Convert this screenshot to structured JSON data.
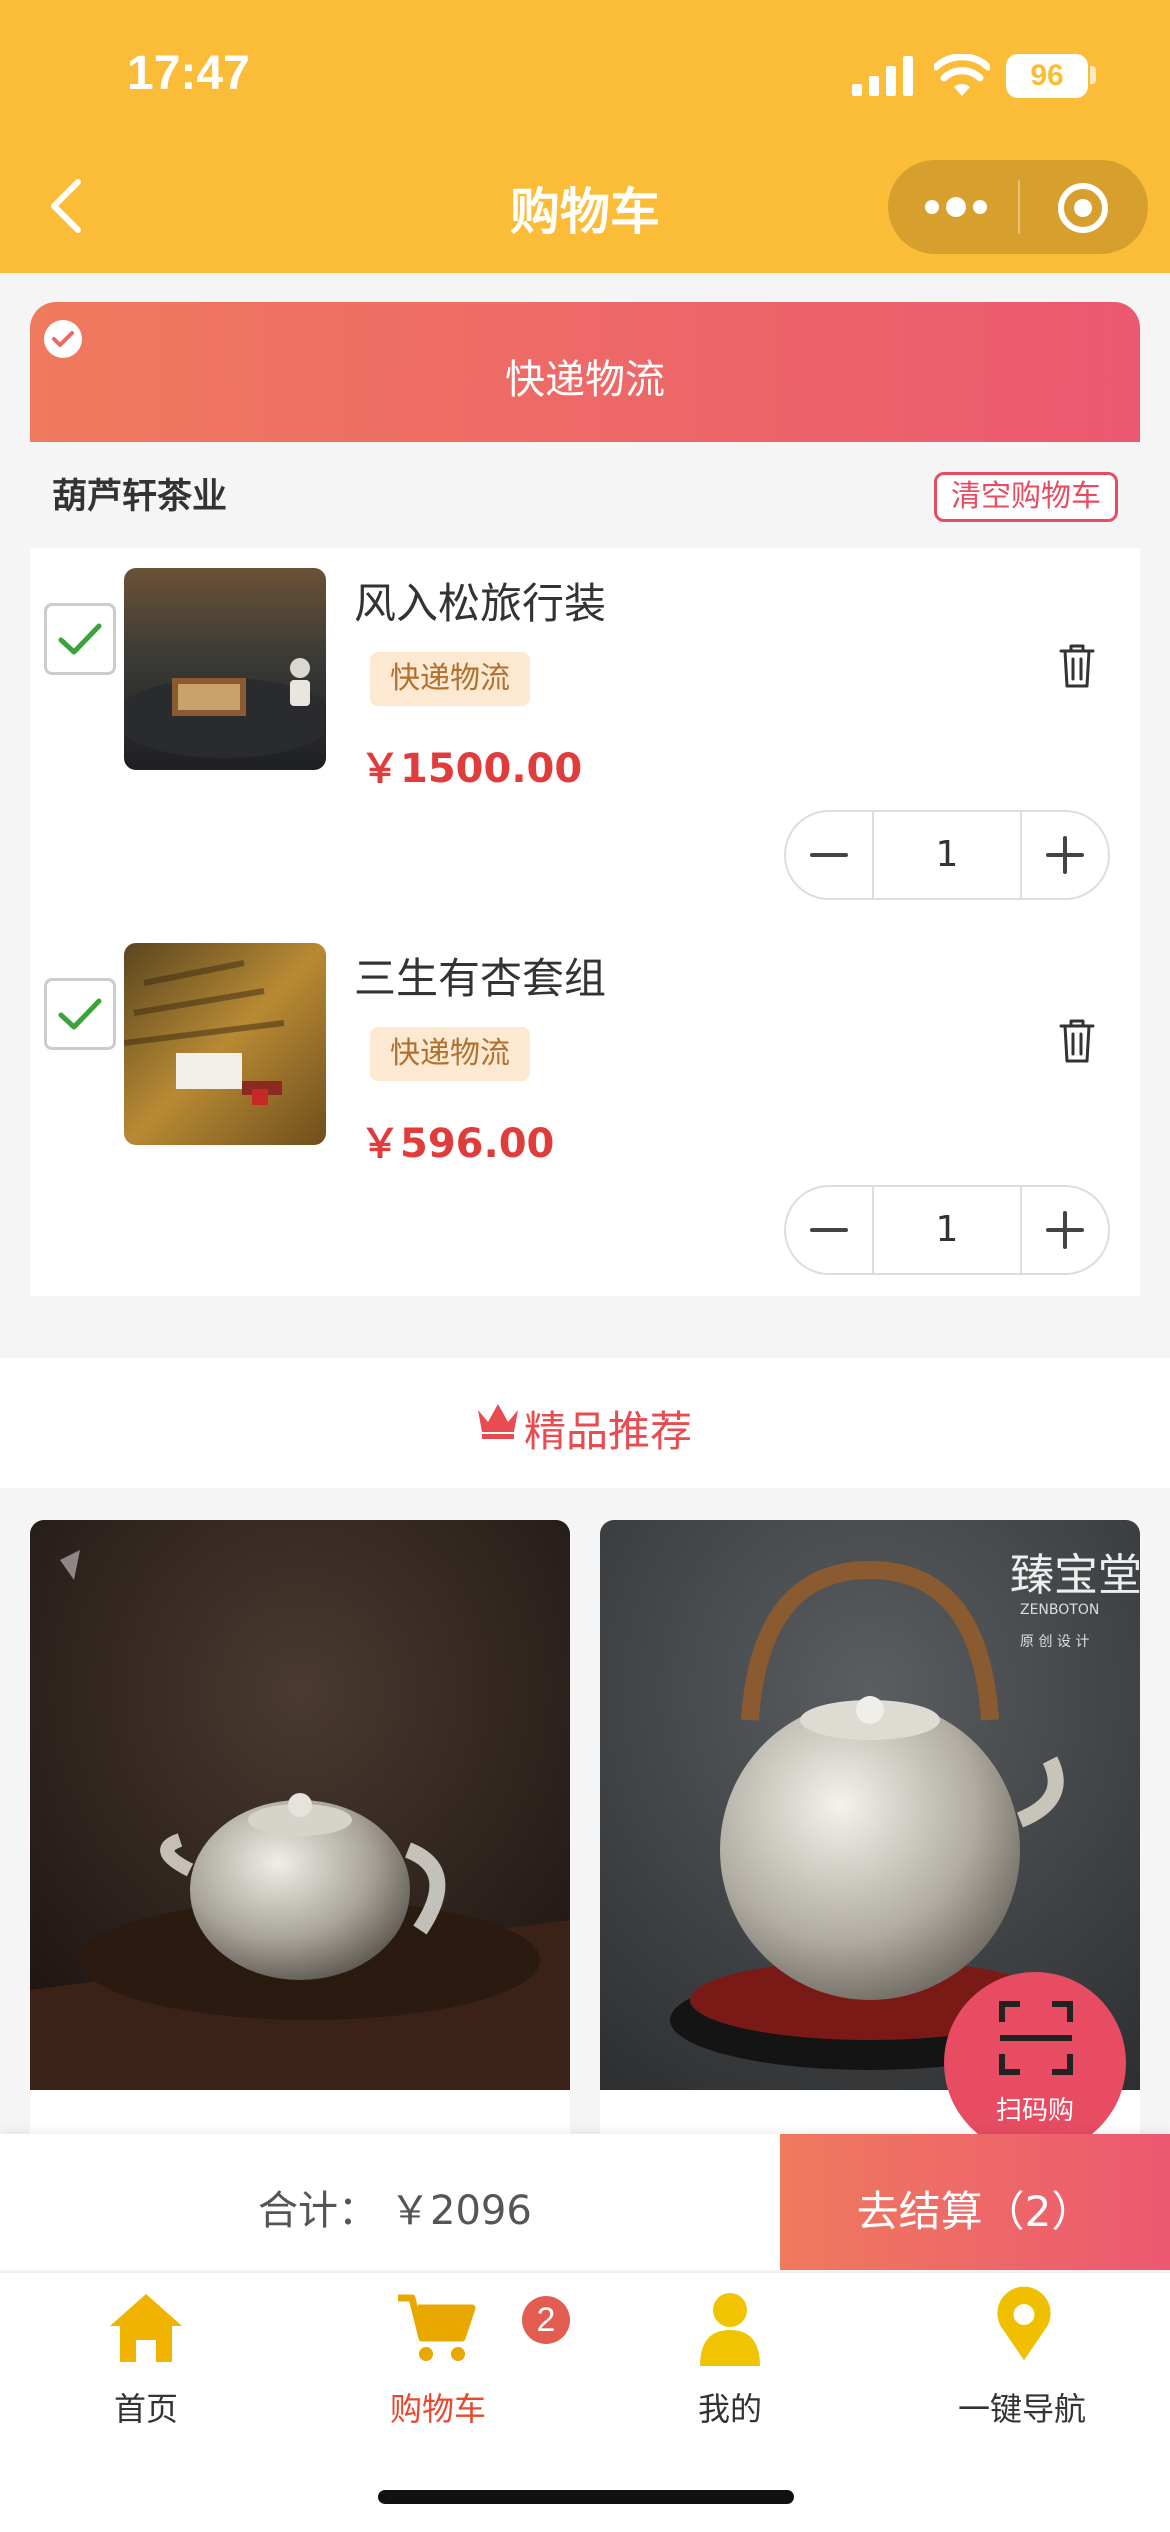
{
  "status_bar": {
    "time": "17:47",
    "battery": "96"
  },
  "header": {
    "title": "购物车"
  },
  "delivery_tab": {
    "label": "快递物流"
  },
  "shop": {
    "name": "葫芦轩茶业",
    "clear_label": "清空购物车"
  },
  "cart": {
    "items": [
      {
        "name": "风入松旅行装",
        "tag": "快递物流",
        "price": "￥1500.00",
        "quantity": "1",
        "checked": true
      },
      {
        "name": "三生有杏套组",
        "tag": "快递物流",
        "price": "￥596.00",
        "quantity": "1",
        "checked": true
      }
    ]
  },
  "recommend": {
    "title": "精品推荐"
  },
  "scan": {
    "label": "扫码购"
  },
  "summary": {
    "total_label": "合计：",
    "total_value": "￥2096",
    "checkout_label": "去结算（2）"
  },
  "tabbar": {
    "items": [
      {
        "label": "首页",
        "icon": "home-icon",
        "active": false
      },
      {
        "label": "购物车",
        "icon": "cart-icon",
        "active": true
      },
      {
        "label": "我的",
        "icon": "user-icon",
        "active": false
      },
      {
        "label": "一键导航",
        "icon": "location-pin-icon",
        "active": false
      }
    ],
    "cart_badge": "2"
  },
  "colors": {
    "header": "#fbbc38",
    "accent": "#e84c63",
    "price": "#e13c3c",
    "tab_active": "#e8a800"
  }
}
